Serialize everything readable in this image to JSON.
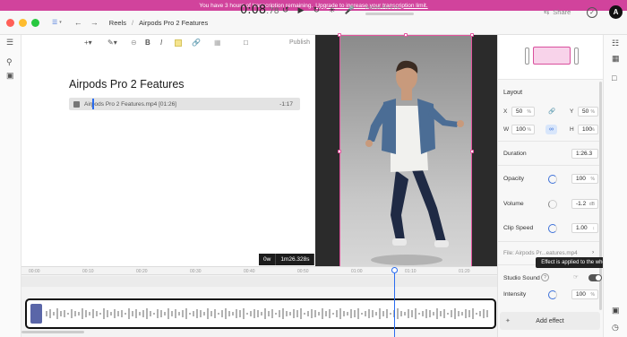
{
  "banner": {
    "text": "You have 3 hours of transcription remaining.",
    "link": "Upgrade to increase your transcription limit."
  },
  "titlebar": {
    "breadcrumb": [
      "Reels",
      "Airpods Pro 2 Features"
    ],
    "timecode_main": "0:08",
    "timecode_frac": ".78",
    "mini_track_label": "Airpods Pro 2 Fe...",
    "share_label": "Share",
    "avatar_letter": "A"
  },
  "editor": {
    "publish_label": "Publish",
    "doc_title": "Airpods Pro 2 Features",
    "clip_name": "Airpods Pro 2 Features.mp4",
    "clip_duration_bracket": "[01:26]",
    "clip_remaining": "-1:17"
  },
  "time_badge": {
    "offset": "0w",
    "total": "1m26.328s"
  },
  "ruler": {
    "ticks": [
      "00:00",
      "00:10",
      "00:20",
      "00:30",
      "00:40",
      "00:50",
      "01:00",
      "01:10",
      "01:20"
    ]
  },
  "panel": {
    "section_layout": "Layout",
    "x_label": "X",
    "x_value": "50",
    "y_label": "Y",
    "y_value": "50",
    "w_label": "W",
    "w_value": "100",
    "h_label": "H",
    "h_value": "100",
    "percent": "%",
    "duration_label": "Duration",
    "duration_value": "1:26.3",
    "opacity_label": "Opacity",
    "opacity_value": "100",
    "volume_label": "Volume",
    "volume_value": "-1.2",
    "volume_unit": "dB",
    "clip_speed_label": "Clip Speed",
    "clip_speed_value": "1.00",
    "file_label": "File: Airpods Pr...eatures.mp4",
    "studio_sound_label": "Studio Sound",
    "intensity_label": "Intensity",
    "intensity_value": "100",
    "add_effect_label": "Add effect",
    "tooltip": "Effect is applied to the whole file"
  },
  "colors": {
    "banner": "#d1439c",
    "accent": "#2a6cf0",
    "selection": "#e4559f"
  }
}
